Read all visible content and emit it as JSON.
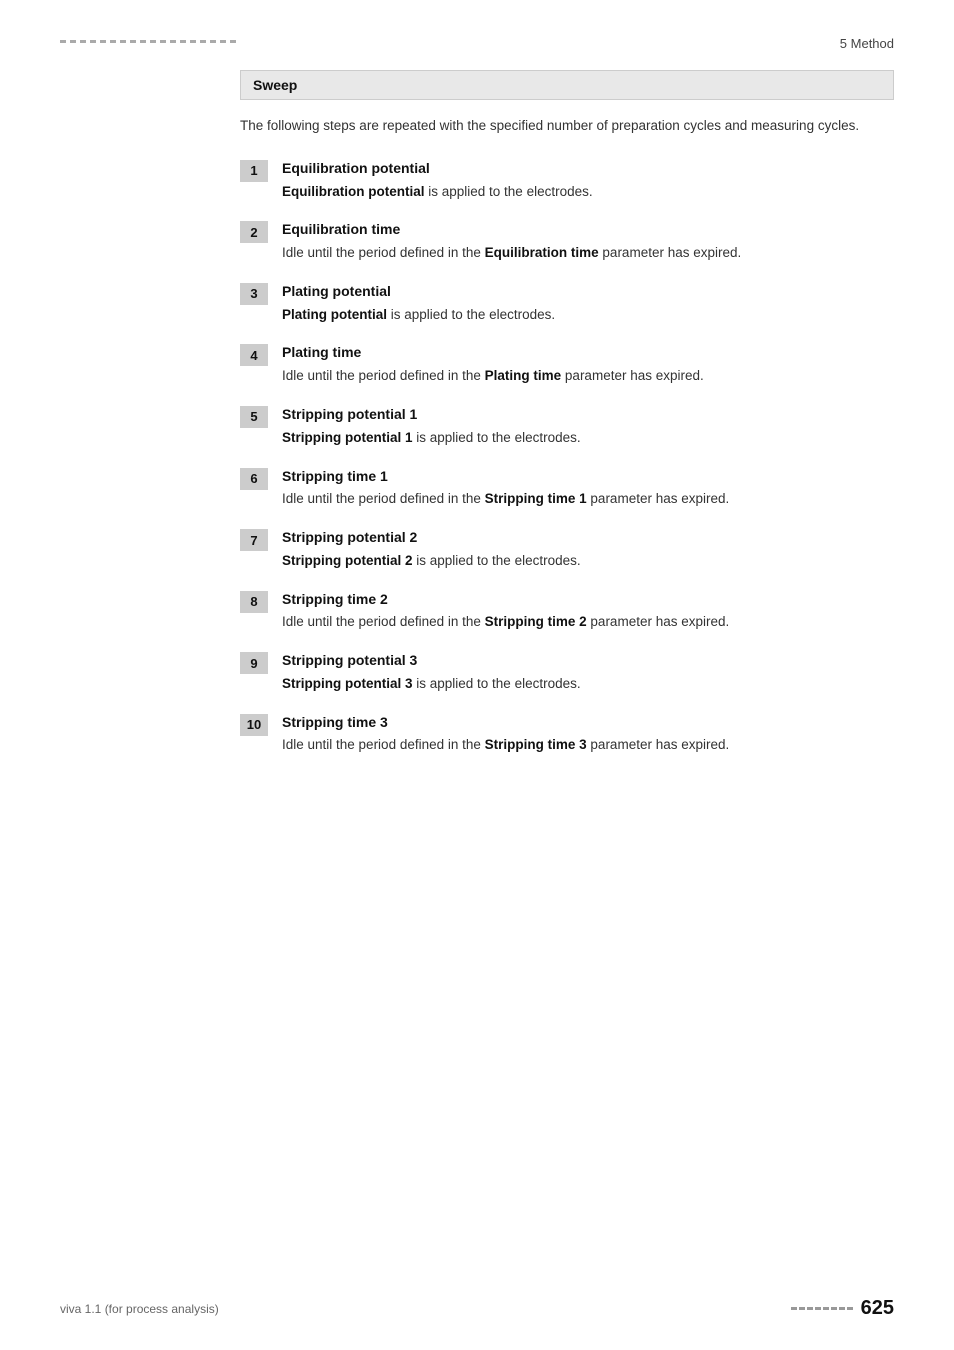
{
  "page": {
    "top_decoration": "dashed-line",
    "header": {
      "section": "5 Method"
    },
    "sweep_box": {
      "title": "Sweep"
    },
    "intro": "The following steps are repeated with the specified number of preparation cycles and measuring cycles.",
    "steps": [
      {
        "number": "1",
        "title": "Equilibration potential",
        "description_pre": "",
        "bold_term": "Equilibration potential",
        "description_post": " is applied to the electrodes."
      },
      {
        "number": "2",
        "title": "Equilibration time",
        "description_pre": "Idle until the period defined in the ",
        "bold_term": "Equilibration time",
        "description_post": " parameter has expired."
      },
      {
        "number": "3",
        "title": "Plating potential",
        "description_pre": "",
        "bold_term": "Plating potential",
        "description_post": " is applied to the electrodes."
      },
      {
        "number": "4",
        "title": "Plating time",
        "description_pre": "Idle until the period defined in the ",
        "bold_term": "Plating time",
        "description_post": " parameter has expired."
      },
      {
        "number": "5",
        "title": "Stripping potential 1",
        "description_pre": "",
        "bold_term": "Stripping potential 1",
        "description_post": " is applied to the electrodes."
      },
      {
        "number": "6",
        "title": "Stripping time 1",
        "description_pre": "Idle until the period defined in the ",
        "bold_term": "Stripping time 1",
        "description_post": " parameter has expired."
      },
      {
        "number": "7",
        "title": "Stripping potential 2",
        "description_pre": "",
        "bold_term": "Stripping potential 2",
        "description_post": " is applied to the electrodes."
      },
      {
        "number": "8",
        "title": "Stripping time 2",
        "description_pre": "Idle until the period defined in the ",
        "bold_term": "Stripping time 2",
        "description_post": " parameter has expired."
      },
      {
        "number": "9",
        "title": "Stripping potential 3",
        "description_pre": "",
        "bold_term": "Stripping potential 3",
        "description_post": " is applied to the electrodes."
      },
      {
        "number": "10",
        "title": "Stripping time 3",
        "description_pre": "Idle until the period defined in the ",
        "bold_term": "Stripping time 3",
        "description_post": " parameter has expired."
      }
    ],
    "footer": {
      "left": "viva 1.1 (for process analysis)",
      "page_number": "625"
    }
  }
}
